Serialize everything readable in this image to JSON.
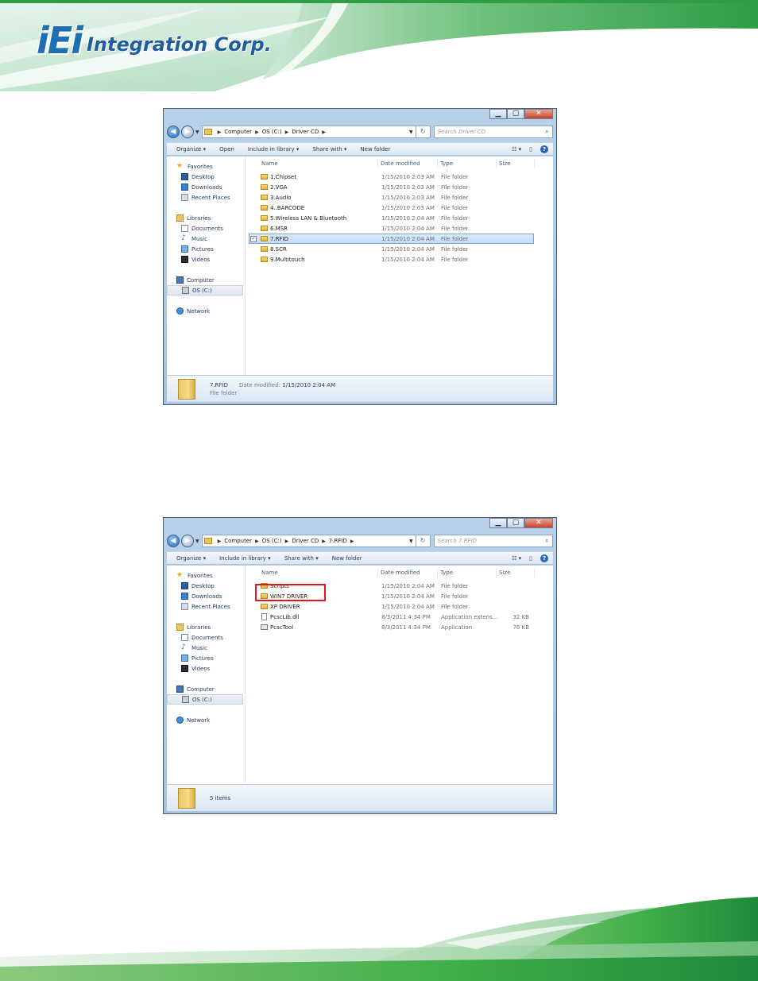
{
  "logo": {
    "mark": "iEi",
    "name": "Integration Corp."
  },
  "window1": {
    "address": [
      "Computer",
      "OS (C:)",
      "Driver CD"
    ],
    "search_placeholder": "Search Driver CD",
    "commands": [
      "Organize ▾",
      "Open",
      "Include in library ▾",
      "Share with ▾",
      "New folder"
    ],
    "nav": {
      "favorites": "Favorites",
      "desktop": "Desktop",
      "downloads": "Downloads",
      "recent": "Recent Places",
      "libraries": "Libraries",
      "documents": "Documents",
      "music": "Music",
      "pictures": "Pictures",
      "videos": "Videos",
      "computer": "Computer",
      "drive": "OS (C:)",
      "network": "Network"
    },
    "columns": {
      "name": "Name",
      "date": "Date modified",
      "type": "Type",
      "size": "Size"
    },
    "files": [
      {
        "name": "1.Chipset",
        "date": "1/15/2010 2:03 AM",
        "type": "File folder",
        "size": ""
      },
      {
        "name": "2.VGA",
        "date": "1/15/2010 2:03 AM",
        "type": "File folder",
        "size": ""
      },
      {
        "name": "3.Audio",
        "date": "1/15/2010 2:03 AM",
        "type": "File folder",
        "size": ""
      },
      {
        "name": "4..BARCODE",
        "date": "1/15/2010 2:03 AM",
        "type": "File folder",
        "size": ""
      },
      {
        "name": "5.Wireless LAN & Bluetooth",
        "date": "1/15/2010 2:04 AM",
        "type": "File folder",
        "size": ""
      },
      {
        "name": "6.MSR",
        "date": "1/15/2010 2:04 AM",
        "type": "File folder",
        "size": ""
      },
      {
        "name": "7.RFID",
        "date": "1/15/2010 2:04 AM",
        "type": "File folder",
        "size": ""
      },
      {
        "name": "8.SCR",
        "date": "1/15/2010 2:04 AM",
        "type": "File folder",
        "size": ""
      },
      {
        "name": "9.Multitouch",
        "date": "1/15/2010 2:04 AM",
        "type": "File folder",
        "size": ""
      }
    ],
    "details": {
      "name": "7.RFID",
      "date_label": "Date modified:",
      "date": "1/15/2010 2:04 AM",
      "kind": "File folder"
    }
  },
  "window2": {
    "address": [
      "Computer",
      "OS (C:)",
      "Driver CD",
      "7.RFID"
    ],
    "search_placeholder": "Search 7.RFID",
    "commands": [
      "Organize ▾",
      "Include in library ▾",
      "Share with ▾",
      "New folder"
    ],
    "nav": {
      "favorites": "Favorites",
      "desktop": "Desktop",
      "downloads": "Downloads",
      "recent": "Recent Places",
      "libraries": "Libraries",
      "documents": "Documents",
      "music": "Music",
      "pictures": "Pictures",
      "videos": "Videos",
      "computer": "Computer",
      "drive": "OS (C:)",
      "network": "Network"
    },
    "columns": {
      "name": "Name",
      "date": "Date modified",
      "type": "Type",
      "size": "Size"
    },
    "files": [
      {
        "name": "Scripts",
        "date": "1/15/2010 2:04 AM",
        "type": "File folder",
        "size": ""
      },
      {
        "name": "WIN7 DRIVER",
        "date": "1/15/2010 2:04 AM",
        "type": "File folder",
        "size": ""
      },
      {
        "name": "XP DRIVER",
        "date": "1/15/2010 2:04 AM",
        "type": "File folder",
        "size": ""
      },
      {
        "name": "PcscLib.dll",
        "date": "8/3/2011 4:34 PM",
        "type": "Application extens...",
        "size": "32 KB"
      },
      {
        "name": "PcscTool",
        "date": "8/3/2011 4:34 PM",
        "type": "Application",
        "size": "76 KB"
      }
    ],
    "details": {
      "count": "5 items"
    }
  },
  "colors": {
    "accent_green": "#3fae49",
    "logo_blue": "#1f6fb5",
    "highlight_red": "#e8141c",
    "selection": "#c1dcfc"
  }
}
